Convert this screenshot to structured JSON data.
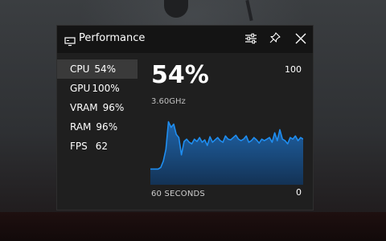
{
  "window": {
    "title": "Performance",
    "icons": [
      "monitor-icon",
      "settings-sliders-icon",
      "pin-icon",
      "close-icon"
    ]
  },
  "metrics": [
    {
      "label": "CPU",
      "value": "54%",
      "active": true
    },
    {
      "label": "GPU",
      "value": "100%",
      "active": false
    },
    {
      "label": "VRAM",
      "value": "96%",
      "active": false
    },
    {
      "label": "RAM",
      "value": "96%",
      "active": false
    },
    {
      "label": "FPS",
      "value": "62",
      "active": false
    }
  ],
  "detail": {
    "current": "54%",
    "clock": "3.60GHz",
    "max_label": "100",
    "min_label": "0",
    "time_label": "60 SECONDS"
  },
  "colors": {
    "accent": "#1f8ef1",
    "panel": "#1f1f1f",
    "titlebar": "#141414"
  },
  "chart_data": {
    "type": "area",
    "ylim": [
      0,
      100
    ],
    "x": [
      0,
      1,
      2,
      3,
      4,
      5,
      6,
      7,
      8,
      9,
      10,
      11,
      12,
      13,
      14,
      15,
      16,
      17,
      18,
      19,
      20,
      21,
      22,
      23,
      24,
      25,
      26,
      27,
      28,
      29,
      30,
      31,
      32,
      33,
      34,
      35,
      36,
      37,
      38,
      39,
      40,
      41,
      42,
      43,
      44,
      45,
      46,
      47,
      48,
      49,
      50,
      51,
      52,
      53,
      54,
      55,
      56,
      57,
      58,
      59
    ],
    "values": [
      20,
      20,
      20,
      20,
      22,
      30,
      45,
      80,
      73,
      77,
      64,
      60,
      38,
      55,
      58,
      54,
      52,
      58,
      55,
      60,
      54,
      57,
      50,
      61,
      54,
      57,
      60,
      56,
      54,
      62,
      58,
      57,
      60,
      63,
      58,
      56,
      58,
      62,
      54,
      56,
      60,
      57,
      53,
      58,
      56,
      58,
      60,
      54,
      66,
      56,
      70,
      58,
      56,
      52,
      60,
      58,
      62,
      56,
      60,
      58
    ],
    "title": "",
    "xlabel": "60 SECONDS",
    "ylabel": ""
  }
}
